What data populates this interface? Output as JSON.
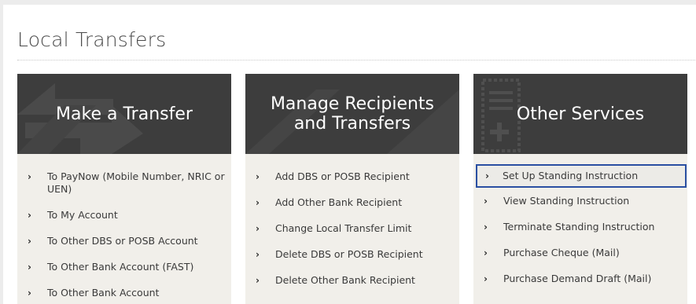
{
  "page": {
    "title": "Local Transfers"
  },
  "panels": [
    {
      "heading": "Make a Transfer",
      "icon": "transfer-arrows-icon",
      "links": [
        "To PayNow (Mobile Number, NRIC or UEN)",
        "To My Account",
        "To Other DBS or POSB Account",
        "To Other Bank Account (FAST)",
        "To Other Bank Account"
      ]
    },
    {
      "heading_line1": "Manage Recipients",
      "heading_line2": "and Transfers",
      "icon": "recipients-icon",
      "links": [
        "Add DBS or POSB Recipient",
        "Add Other Bank Recipient",
        "Change Local Transfer Limit",
        "Delete DBS or POSB Recipient",
        "Delete Other Bank Recipient"
      ]
    },
    {
      "heading": "Other Services",
      "icon": "document-stamp-icon",
      "links": [
        "Set Up Standing Instruction",
        "View Standing Instruction",
        "Terminate Standing Instruction",
        "Purchase Cheque (Mail)",
        "Purchase Demand Draft (Mail)"
      ]
    }
  ],
  "colors": {
    "banner": "#3d3d3d",
    "panel_bg": "#f1efea",
    "selection_border": "#2a4fa2"
  }
}
